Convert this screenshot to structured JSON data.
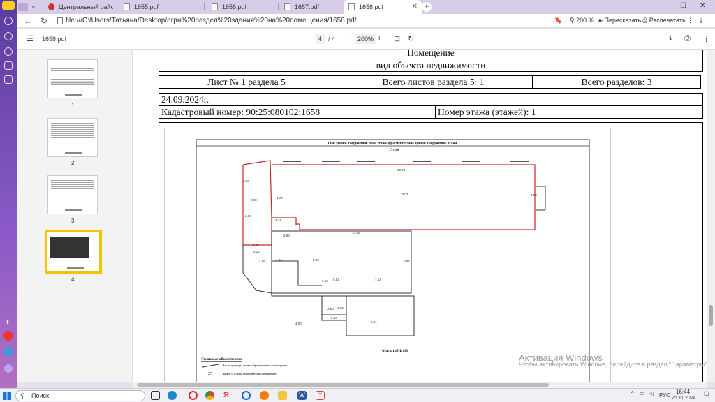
{
  "browser": {
    "tabs": [
      {
        "title": "Центральный район Пол",
        "active": false
      },
      {
        "title": "1655.pdf",
        "active": false
      },
      {
        "title": "1656.pdf",
        "active": false
      },
      {
        "title": "1657.pdf",
        "active": false
      },
      {
        "title": "1658.pdf",
        "active": true
      }
    ],
    "url": "file:///C:/Users/Татьяна/Desktop/егрн%20раздел%20здания%20на%20помещения/1658.pdf",
    "zoom_badge": "200 %",
    "retell_label": "Пересказать",
    "print_label": "Распечатать"
  },
  "pdf_toolbar": {
    "file_name": "1658.pdf",
    "page_current": "4",
    "page_total": "/ 4",
    "zoom": "200%"
  },
  "thumbnails": [
    {
      "number": "1"
    },
    {
      "number": "2"
    },
    {
      "number": "3"
    },
    {
      "number": "4",
      "selected": true
    }
  ],
  "document": {
    "row_room": "Помещение",
    "row_object_type": "вид объекта недвижимости",
    "sheet_label": "Лист № 1 раздела 5",
    "total_sheets_label": "Всего листов раздела 5: 1",
    "total_sections_label": "Всего разделов: 3",
    "date": "24.09.2024г.",
    "cadastral_number": "Кадастровый номер: 90:25:080102:1658",
    "floor_number": "Номер этажа (этажей): 1",
    "plan_title": "План здания, сооружения, план этажа, фрагмент плана здания, сооружения, этажа",
    "floor_caption": "1 Этаж",
    "scale": "Масштаб 1:100",
    "legend_title": "Условные обозначения:",
    "legend_items": [
      "- Часть границы вновь образованного помещения",
      "- номер и площадь комнаты в помещении"
    ],
    "dims": [
      "16,70",
      "122,3",
      "6,86",
      "3,80",
      "2,00",
      "4,72",
      "2,88",
      "3,34",
      "2,96",
      "10,50",
      "5,82",
      "3,80",
      "3,20",
      "4,65",
      "4,34",
      "5,00",
      "3,20",
      "7,14",
      "5,82",
      "2,51",
      "1,88",
      "2,60",
      "3,60",
      "4,00"
    ]
  },
  "activation": {
    "title": "Активация Windows",
    "subtitle": "Чтобы активировать Windows, перейдите в раздел \"Параметры\"."
  },
  "taskbar": {
    "search_placeholder": "Поиск",
    "language": "РУС",
    "time": "16:44",
    "date": "26.11.2024"
  }
}
